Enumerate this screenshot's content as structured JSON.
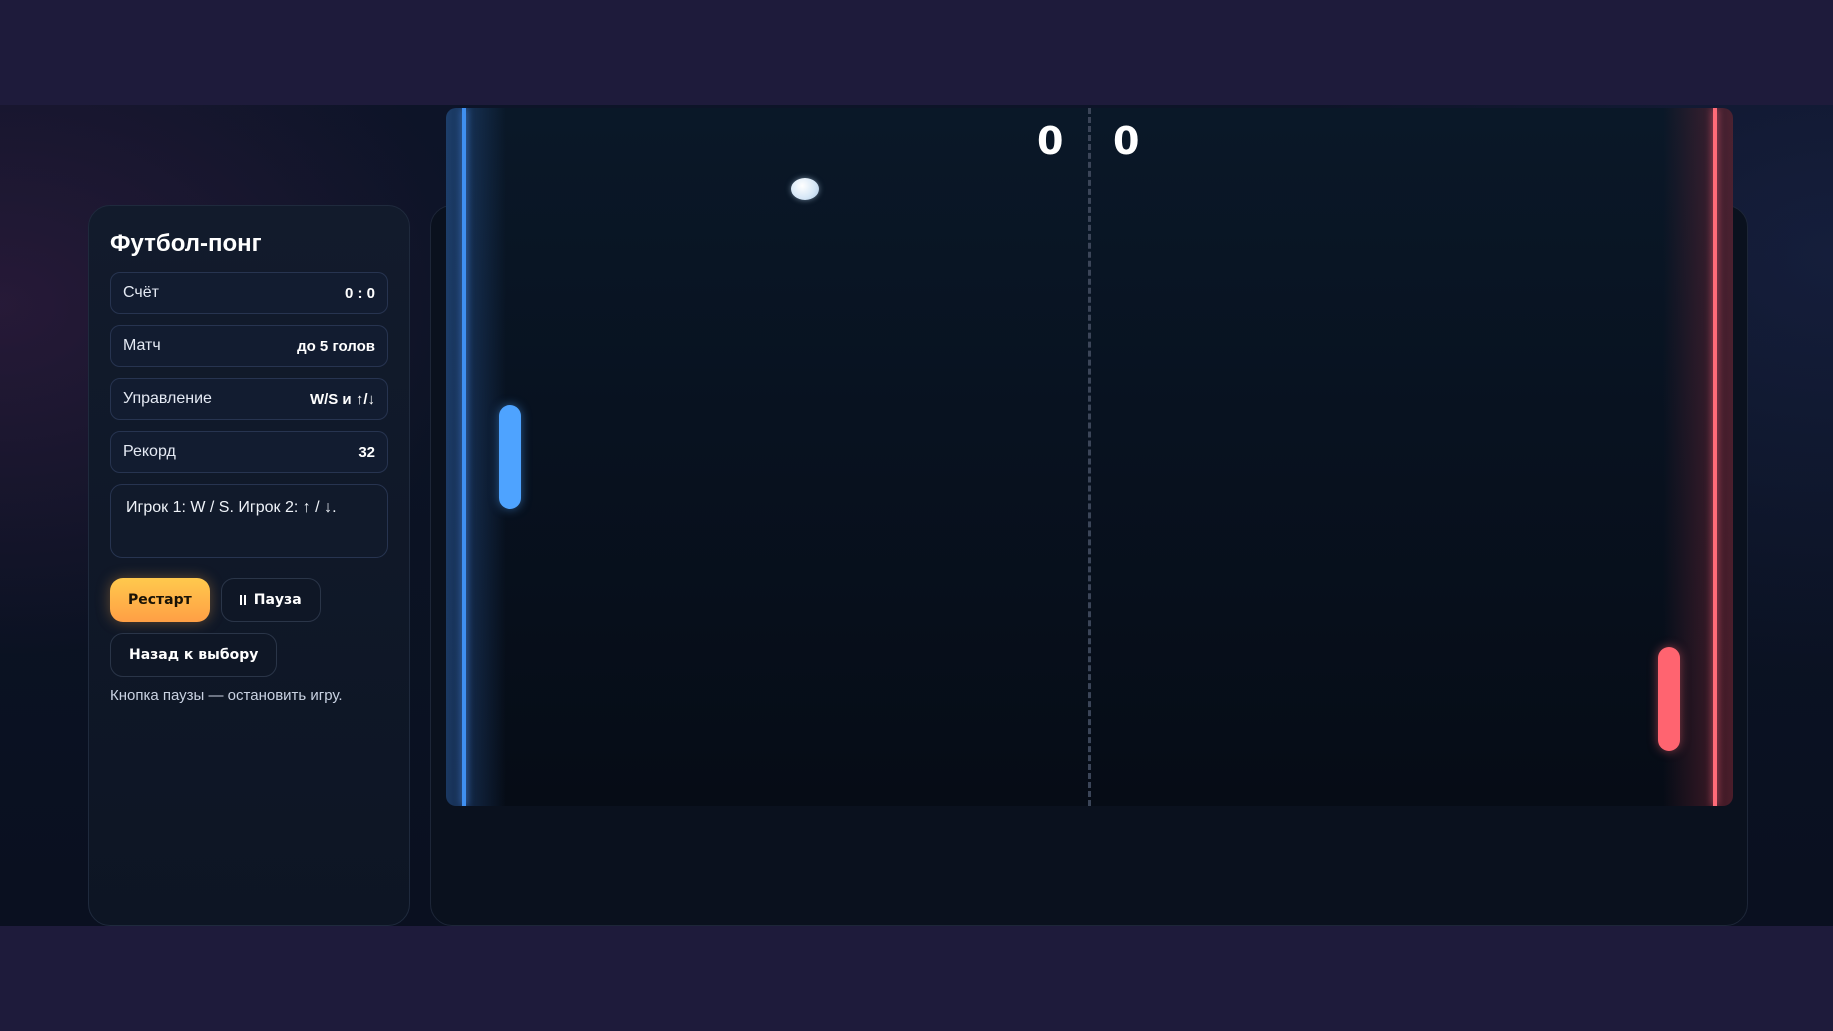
{
  "sidebar": {
    "title": "Футбол-понг",
    "stats": [
      {
        "label": "Счёт",
        "value": "0 : 0"
      },
      {
        "label": "Матч",
        "value": "до 5 голов"
      },
      {
        "label": "Управление",
        "value": "W/S и ↑/↓"
      },
      {
        "label": "Рекорд",
        "value": "32"
      }
    ],
    "message": "Игрок 1: W / S. Игрок 2: ↑ / ↓.",
    "buttons": {
      "restart": "Рестарт",
      "pause": "Пауза",
      "back": "Назад к выбору"
    },
    "hint": "Кнопка паузы — остановить игру."
  },
  "game": {
    "score_left": "0",
    "score_right": "0",
    "colors": {
      "player1": "#4ea3ff",
      "player2": "#ff6470",
      "accent": "#ffb347"
    }
  }
}
